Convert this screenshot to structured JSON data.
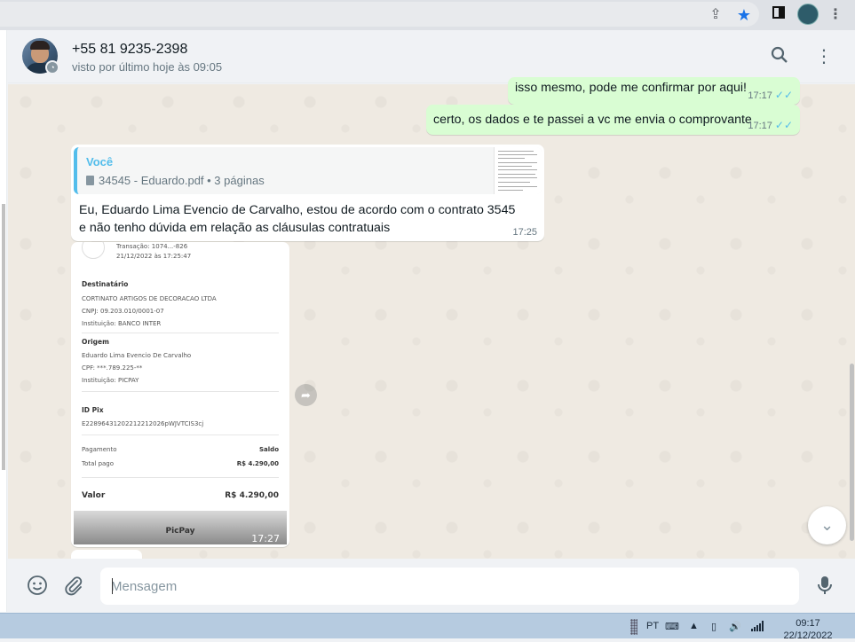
{
  "browser": {
    "icons": [
      "share-icon",
      "star-icon",
      "sidebar-icon",
      "profile-avatar",
      "menu-icon"
    ]
  },
  "header": {
    "contact_name": "+55 81 9235-2398",
    "status": "visto por último hoje às 09:05"
  },
  "messages": [
    {
      "direction": "out",
      "text": "isso mesmo, pode me confirmar por aqui!",
      "time": "17:17",
      "ticks": "✓✓"
    },
    {
      "direction": "out",
      "text": "certo, os dados e te passei a vc me envia o comprovante",
      "time": "17:17",
      "ticks": "✓✓"
    },
    {
      "direction": "in",
      "quote": {
        "author": "Você",
        "file": "34545 - Eduardo.pdf • 3 páginas"
      },
      "text": "Eu, Eduardo Lima Evencio de Carvalho, estou de acordo com o contrato 3545 e não tenho dúvida em relação as cláusulas contratuais",
      "time": "17:25"
    },
    {
      "direction": "in",
      "type": "image",
      "time": "17:27",
      "receipt": {
        "top_line_1": "Transação: 1074...-826",
        "top_line_2": "21/12/2022 às 17:25:47",
        "dest_title": "Destinatário",
        "dest_name": "CORTINATO ARTIGOS DE DECORACAO LTDA",
        "dest_cnpj": "CNPJ: 09.203.010/0001-07",
        "dest_inst": "Instituição: BANCO INTER",
        "orig_title": "Origem",
        "orig_name": "Eduardo Lima Evencio De Carvalho",
        "orig_cpf": "CPF: ***.789.225-**",
        "orig_inst": "Instituição: PICPAY",
        "pix_title": "ID Pix",
        "pix_id": "E22896431202212212026pWJVTCIS3cj",
        "pay_label": "Pagamento",
        "pay_value": "Saldo",
        "total_label": "Total pago",
        "total_value": "R$ 4.290,00",
        "valor_label": "Valor",
        "valor_value": "R$ 4.290,00",
        "brand": "PicPay"
      }
    }
  ],
  "composer": {
    "placeholder": "Mensagem"
  },
  "taskbar": {
    "language": "PT",
    "time": "09:17",
    "date": "22/12/2022"
  }
}
